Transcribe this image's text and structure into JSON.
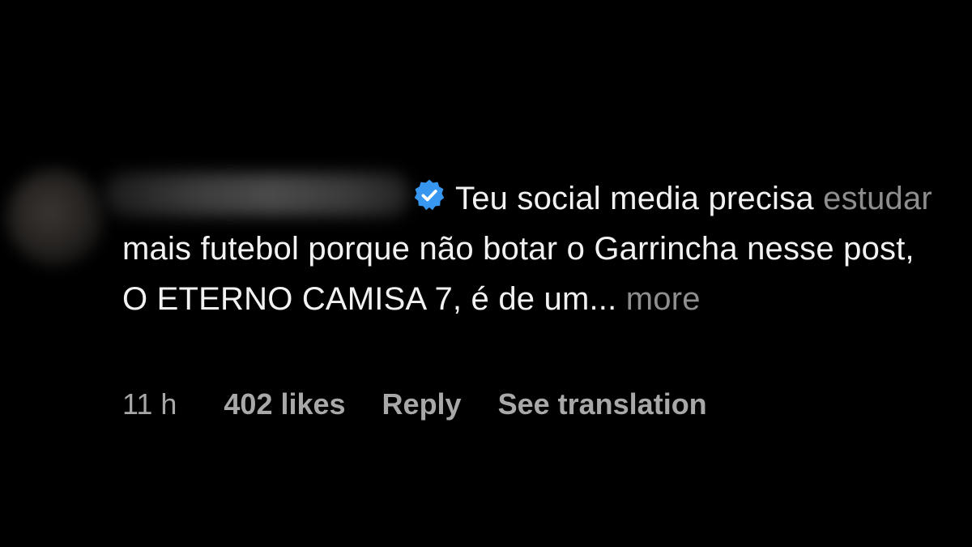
{
  "comment": {
    "verified": true,
    "text_lead": "Teu social media precisa",
    "text_dim": "estudar",
    "text_body": "mais futebol porque não botar o Garrincha nesse post, O ETERNO CAMISA 7, é de um...",
    "more_label": "more",
    "time": "11 h",
    "likes": "402 likes",
    "reply_label": "Reply",
    "translation_label": "See translation"
  },
  "colors": {
    "background": "#000000",
    "text": "#f2f2f2",
    "secondary": "#a8a8a8",
    "verified_badge": "#3797f0"
  },
  "icons": {
    "verified": "verified-badge-icon"
  }
}
